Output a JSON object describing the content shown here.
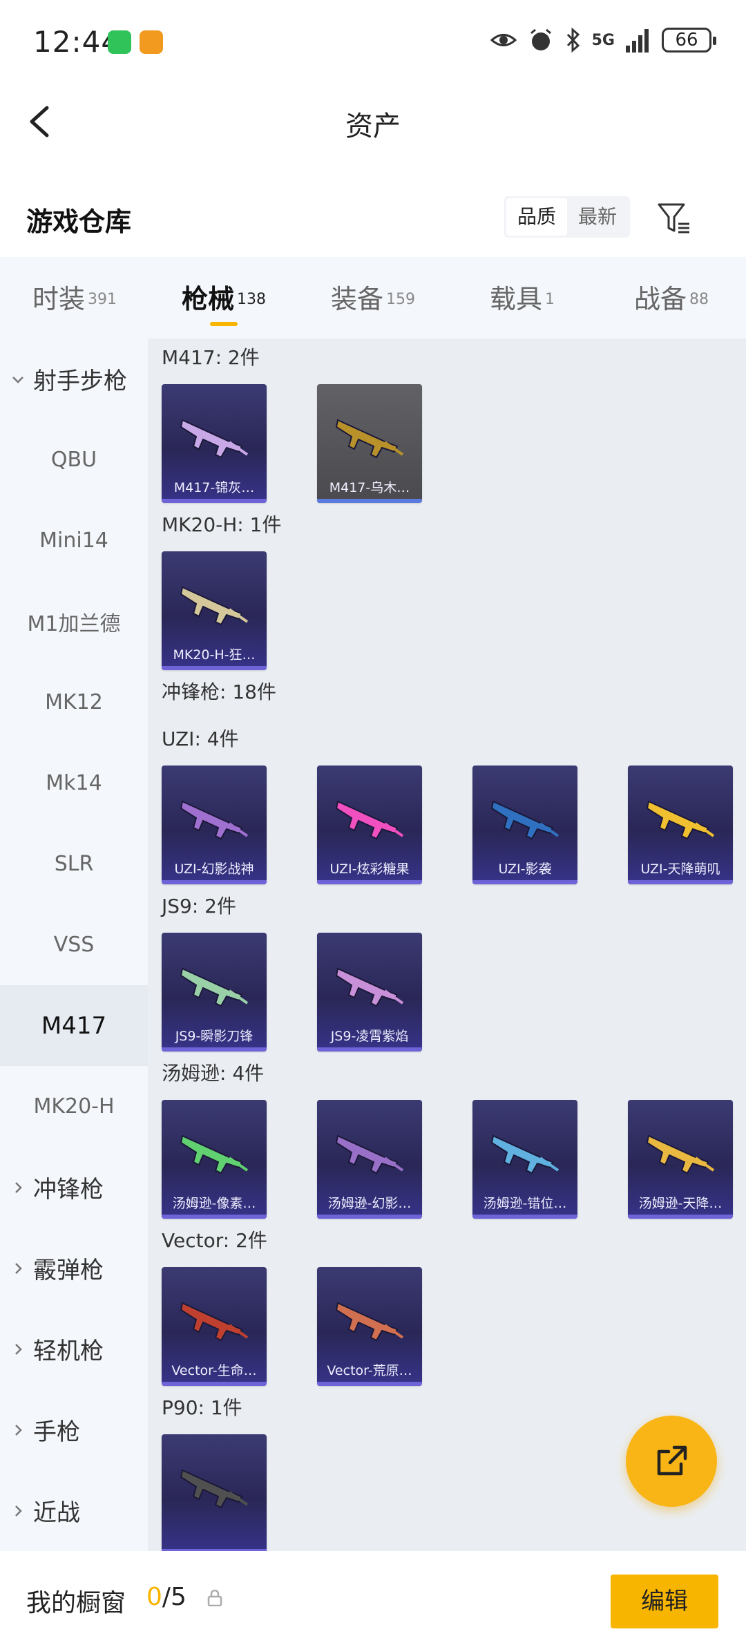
{
  "status_bar": {
    "time": "12:44",
    "network": "5G",
    "battery": "66"
  },
  "header": {
    "title": "资产"
  },
  "section": {
    "title": "游戏仓库",
    "sort_options": [
      "品质",
      "最新"
    ],
    "sort_selected": "品质"
  },
  "category_tabs": [
    {
      "label": "时装",
      "count": "391"
    },
    {
      "label": "枪械",
      "count": "138",
      "active": true
    },
    {
      "label": "装备",
      "count": "159"
    },
    {
      "label": "载具",
      "count": "1"
    },
    {
      "label": "战备",
      "count": "88"
    }
  ],
  "sidebar": {
    "items": [
      {
        "label": "射手步枪",
        "type": "group-expanded"
      },
      {
        "label": "QBU"
      },
      {
        "label": "Mini14"
      },
      {
        "label": "M1加兰德"
      },
      {
        "label": "MK12"
      },
      {
        "label": "Mk14"
      },
      {
        "label": "SLR"
      },
      {
        "label": "VSS"
      },
      {
        "label": "M417",
        "active": true
      },
      {
        "label": "MK20-H"
      },
      {
        "label": "冲锋枪",
        "type": "group"
      },
      {
        "label": "霰弹枪",
        "type": "group"
      },
      {
        "label": "轻机枪",
        "type": "group"
      },
      {
        "label": "手枪",
        "type": "group"
      },
      {
        "label": "近战",
        "type": "group"
      }
    ]
  },
  "groups": [
    {
      "label": "M417: 2件",
      "items": [
        {
          "name": "M417-锦灰…",
          "color": "#c9a8e8"
        },
        {
          "name": "M417-乌木…",
          "color": "#b8912a",
          "bg": "gray"
        }
      ]
    },
    {
      "label": "MK20-H: 1件",
      "items": [
        {
          "name": "MK20-H-狂…",
          "color": "#d4c79a"
        }
      ]
    },
    {
      "label": "冲锋枪: 18件",
      "items": []
    },
    {
      "label": "UZI: 4件",
      "items": [
        {
          "name": "UZI-幻影战神",
          "color": "#a070d0"
        },
        {
          "name": "UZI-炫彩糖果",
          "color": "#f050c0"
        },
        {
          "name": "UZI-影袭",
          "color": "#3070c0"
        },
        {
          "name": "UZI-天降萌叽",
          "color": "#f0c030"
        }
      ]
    },
    {
      "label": "JS9: 2件",
      "items": [
        {
          "name": "JS9-瞬影刀锋",
          "color": "#9ad0a8"
        },
        {
          "name": "JS9-凌霄紫焰",
          "color": "#c890d8"
        }
      ]
    },
    {
      "label": "汤姆逊: 4件",
      "items": [
        {
          "name": "汤姆逊-像素…",
          "color": "#60d070"
        },
        {
          "name": "汤姆逊-幻影…",
          "color": "#9870c8"
        },
        {
          "name": "汤姆逊-错位…",
          "color": "#60b0e0"
        },
        {
          "name": "汤姆逊-天降…",
          "color": "#e8b840"
        }
      ]
    },
    {
      "label": "Vector: 2件",
      "items": [
        {
          "name": "Vector-生命…",
          "color": "#c04030"
        },
        {
          "name": "Vector-荒原…",
          "color": "#d07050"
        }
      ]
    },
    {
      "label": "P90: 1件",
      "items": [
        {
          "name": "",
          "color": "#505050"
        }
      ]
    }
  ],
  "bottom_bar": {
    "label": "我的橱窗",
    "current": "0",
    "total": "/5",
    "edit_label": "编辑"
  },
  "colors": {
    "accent": "#f7b500",
    "card_bg": "#2a2757",
    "sidebar_bg": "#f4f7fb",
    "main_bg": "#eaeef3"
  }
}
